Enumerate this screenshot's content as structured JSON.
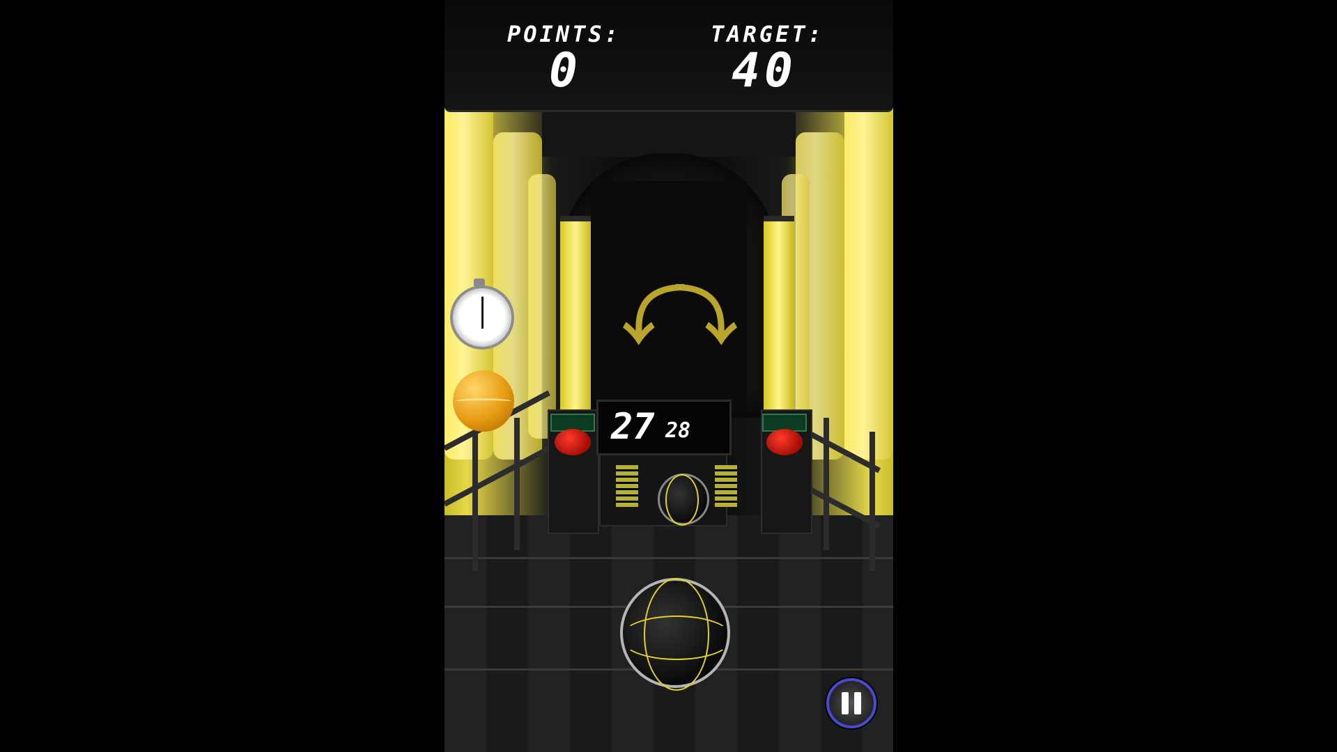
{
  "scoreboard": {
    "points_label": "POINTS:",
    "points_value": "0",
    "target_label": "TARGET:",
    "target_value": "40"
  },
  "timer": {
    "seconds": "27",
    "hundredths": "28"
  },
  "icons": {
    "stopwatch": "stopwatch-icon",
    "bonus_ball": "golden-basketball-icon",
    "pause": "pause-icon",
    "swipe_arrows": "curved-arrows-icon"
  },
  "colors": {
    "neon_yellow": "#f2e45a",
    "seam_yellow": "#e4d22a",
    "pause_ring": "#4a4ad0",
    "red_button": "#d8180c"
  }
}
